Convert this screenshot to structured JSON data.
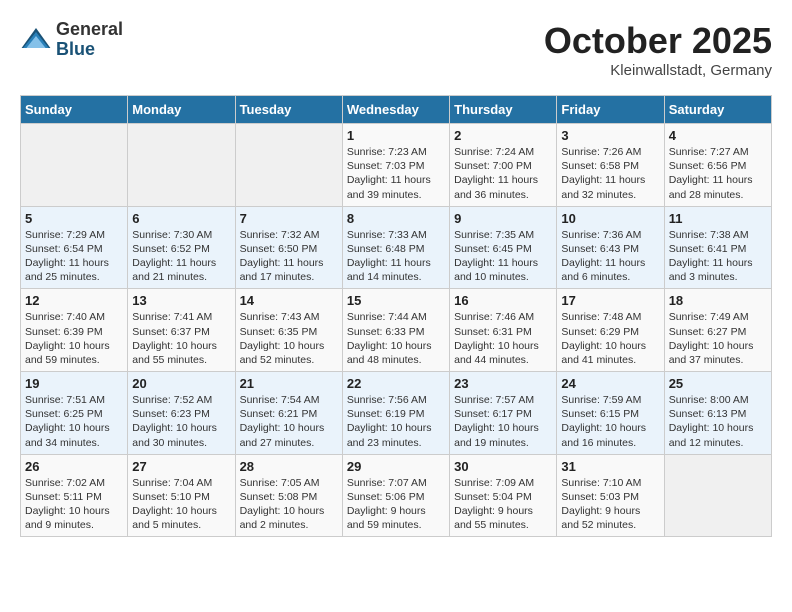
{
  "header": {
    "logo_general": "General",
    "logo_blue": "Blue",
    "month_title": "October 2025",
    "location": "Kleinwallstadt, Germany"
  },
  "days_of_week": [
    "Sunday",
    "Monday",
    "Tuesday",
    "Wednesday",
    "Thursday",
    "Friday",
    "Saturday"
  ],
  "weeks": [
    [
      {
        "day": "",
        "info": ""
      },
      {
        "day": "",
        "info": ""
      },
      {
        "day": "",
        "info": ""
      },
      {
        "day": "1",
        "info": "Sunrise: 7:23 AM\nSunset: 7:03 PM\nDaylight: 11 hours and 39 minutes."
      },
      {
        "day": "2",
        "info": "Sunrise: 7:24 AM\nSunset: 7:00 PM\nDaylight: 11 hours and 36 minutes."
      },
      {
        "day": "3",
        "info": "Sunrise: 7:26 AM\nSunset: 6:58 PM\nDaylight: 11 hours and 32 minutes."
      },
      {
        "day": "4",
        "info": "Sunrise: 7:27 AM\nSunset: 6:56 PM\nDaylight: 11 hours and 28 minutes."
      }
    ],
    [
      {
        "day": "5",
        "info": "Sunrise: 7:29 AM\nSunset: 6:54 PM\nDaylight: 11 hours and 25 minutes."
      },
      {
        "day": "6",
        "info": "Sunrise: 7:30 AM\nSunset: 6:52 PM\nDaylight: 11 hours and 21 minutes."
      },
      {
        "day": "7",
        "info": "Sunrise: 7:32 AM\nSunset: 6:50 PM\nDaylight: 11 hours and 17 minutes."
      },
      {
        "day": "8",
        "info": "Sunrise: 7:33 AM\nSunset: 6:48 PM\nDaylight: 11 hours and 14 minutes."
      },
      {
        "day": "9",
        "info": "Sunrise: 7:35 AM\nSunset: 6:45 PM\nDaylight: 11 hours and 10 minutes."
      },
      {
        "day": "10",
        "info": "Sunrise: 7:36 AM\nSunset: 6:43 PM\nDaylight: 11 hours and 6 minutes."
      },
      {
        "day": "11",
        "info": "Sunrise: 7:38 AM\nSunset: 6:41 PM\nDaylight: 11 hours and 3 minutes."
      }
    ],
    [
      {
        "day": "12",
        "info": "Sunrise: 7:40 AM\nSunset: 6:39 PM\nDaylight: 10 hours and 59 minutes."
      },
      {
        "day": "13",
        "info": "Sunrise: 7:41 AM\nSunset: 6:37 PM\nDaylight: 10 hours and 55 minutes."
      },
      {
        "day": "14",
        "info": "Sunrise: 7:43 AM\nSunset: 6:35 PM\nDaylight: 10 hours and 52 minutes."
      },
      {
        "day": "15",
        "info": "Sunrise: 7:44 AM\nSunset: 6:33 PM\nDaylight: 10 hours and 48 minutes."
      },
      {
        "day": "16",
        "info": "Sunrise: 7:46 AM\nSunset: 6:31 PM\nDaylight: 10 hours and 44 minutes."
      },
      {
        "day": "17",
        "info": "Sunrise: 7:48 AM\nSunset: 6:29 PM\nDaylight: 10 hours and 41 minutes."
      },
      {
        "day": "18",
        "info": "Sunrise: 7:49 AM\nSunset: 6:27 PM\nDaylight: 10 hours and 37 minutes."
      }
    ],
    [
      {
        "day": "19",
        "info": "Sunrise: 7:51 AM\nSunset: 6:25 PM\nDaylight: 10 hours and 34 minutes."
      },
      {
        "day": "20",
        "info": "Sunrise: 7:52 AM\nSunset: 6:23 PM\nDaylight: 10 hours and 30 minutes."
      },
      {
        "day": "21",
        "info": "Sunrise: 7:54 AM\nSunset: 6:21 PM\nDaylight: 10 hours and 27 minutes."
      },
      {
        "day": "22",
        "info": "Sunrise: 7:56 AM\nSunset: 6:19 PM\nDaylight: 10 hours and 23 minutes."
      },
      {
        "day": "23",
        "info": "Sunrise: 7:57 AM\nSunset: 6:17 PM\nDaylight: 10 hours and 19 minutes."
      },
      {
        "day": "24",
        "info": "Sunrise: 7:59 AM\nSunset: 6:15 PM\nDaylight: 10 hours and 16 minutes."
      },
      {
        "day": "25",
        "info": "Sunrise: 8:00 AM\nSunset: 6:13 PM\nDaylight: 10 hours and 12 minutes."
      }
    ],
    [
      {
        "day": "26",
        "info": "Sunrise: 7:02 AM\nSunset: 5:11 PM\nDaylight: 10 hours and 9 minutes."
      },
      {
        "day": "27",
        "info": "Sunrise: 7:04 AM\nSunset: 5:10 PM\nDaylight: 10 hours and 5 minutes."
      },
      {
        "day": "28",
        "info": "Sunrise: 7:05 AM\nSunset: 5:08 PM\nDaylight: 10 hours and 2 minutes."
      },
      {
        "day": "29",
        "info": "Sunrise: 7:07 AM\nSunset: 5:06 PM\nDaylight: 9 hours and 59 minutes."
      },
      {
        "day": "30",
        "info": "Sunrise: 7:09 AM\nSunset: 5:04 PM\nDaylight: 9 hours and 55 minutes."
      },
      {
        "day": "31",
        "info": "Sunrise: 7:10 AM\nSunset: 5:03 PM\nDaylight: 9 hours and 52 minutes."
      },
      {
        "day": "",
        "info": ""
      }
    ]
  ]
}
